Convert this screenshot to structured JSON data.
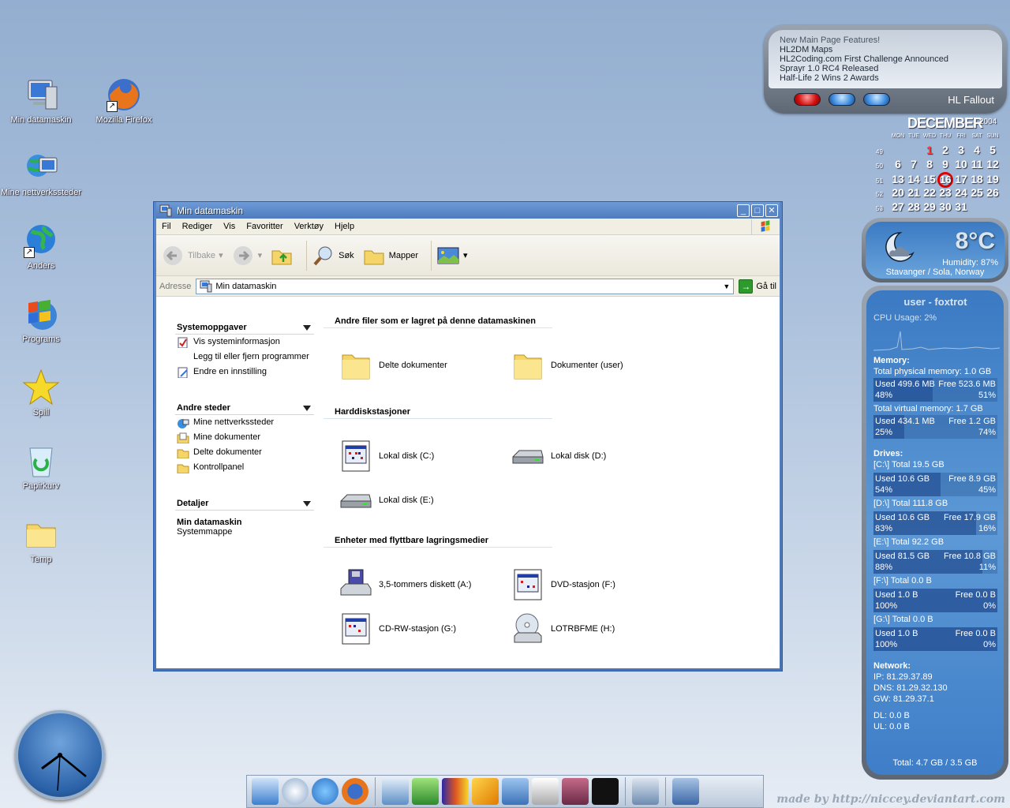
{
  "desktop": {
    "icons": [
      {
        "label": "Min datamaskin",
        "icon": "my-computer-icon"
      },
      {
        "label": "Mozilla Firefox",
        "icon": "firefox-icon"
      },
      {
        "label": "Mine nettverkssteder",
        "icon": "network-places-icon"
      },
      {
        "label": "Anders",
        "icon": "globe-shortcut-icon"
      },
      {
        "label": "Programs",
        "icon": "windows-logo-icon"
      },
      {
        "label": "Spill",
        "icon": "star-icon"
      },
      {
        "label": "Papirkurv",
        "icon": "recycle-bin-icon"
      },
      {
        "label": "Temp",
        "icon": "folder-icon"
      }
    ],
    "credit": "made by http://niccey.deviantart.com"
  },
  "news": {
    "headlines": [
      "New Main Page Features!",
      "HL2DM Maps",
      "HL2Coding.com First Challenge Announced",
      "Sprayr 1.0 RC4 Released",
      "Half-Life 2 Wins 2 Awards"
    ],
    "label": "HL Fallout"
  },
  "calendar": {
    "month": "DECEMBER",
    "year": "2004",
    "weekdays": [
      "MON",
      "TUE",
      "WED",
      "THU",
      "FRI",
      "SAT",
      "SUN"
    ],
    "weeks": [
      {
        "wk": "49",
        "days": [
          "",
          "",
          "1",
          "2",
          "3",
          "4",
          "5"
        ]
      },
      {
        "wk": "50",
        "days": [
          "6",
          "7",
          "8",
          "9",
          "10",
          "11",
          "12"
        ]
      },
      {
        "wk": "51",
        "days": [
          "13",
          "14",
          "15",
          "16",
          "17",
          "18",
          "19"
        ]
      },
      {
        "wk": "52",
        "days": [
          "20",
          "21",
          "22",
          "23",
          "24",
          "25",
          "26"
        ]
      },
      {
        "wk": "53",
        "days": [
          "27",
          "28",
          "29",
          "30",
          "31",
          "",
          ""
        ]
      }
    ],
    "today": "16",
    "colors": {
      "today_ring": "#d00000",
      "sunday": "#ff3a3a"
    }
  },
  "weather": {
    "temp": "8°C",
    "humidity": "Humidity: 87%",
    "location": "Stavanger / Sola, Norway"
  },
  "sysmon": {
    "title": "user - foxtrot",
    "cpu": "CPU Usage: 2%",
    "memory_label": "Memory:",
    "phys_total": "Total physical memory: 1.0 GB",
    "phys": {
      "used": "Used 499.6 MB",
      "free": "Free 523.6 MB",
      "used_pct": "48%",
      "free_pct": "51%",
      "fraction": 0.48
    },
    "virt_total": "Total virtual memory: 1.7 GB",
    "virt": {
      "used": "Used 434.1 MB",
      "free": "Free 1.2 GB",
      "used_pct": "25%",
      "free_pct": "74%",
      "fraction": 0.25
    },
    "drives_label": "Drives:",
    "drives": [
      {
        "total": "[C:\\] Total 19.5 GB",
        "used": "Used 10.6 GB",
        "free": "Free 8.9 GB",
        "used_pct": "54%",
        "free_pct": "45%",
        "fraction": 0.54
      },
      {
        "total": "[D:\\] Total 111.8 GB",
        "used": "Used 10.6 GB",
        "free": "Free 17.9 GB",
        "used_pct": "83%",
        "free_pct": "16%",
        "fraction": 0.83
      },
      {
        "total": "[E:\\] Total 92.2 GB",
        "used": "Used 81.5 GB",
        "free": "Free 10.8 GB",
        "used_pct": "88%",
        "free_pct": "11%",
        "fraction": 0.88
      },
      {
        "total": "[F:\\] Total 0.0 B",
        "used": "Used 1.0 B",
        "free": "Free 0.0 B",
        "used_pct": "100%",
        "free_pct": "0%",
        "fraction": 1.0
      },
      {
        "total": "[G:\\] Total 0.0 B",
        "used": "Used 1.0 B",
        "free": "Free 0.0 B",
        "used_pct": "100%",
        "free_pct": "0%",
        "fraction": 1.0
      }
    ],
    "network_label": "Network:",
    "ip": "IP:  81.29.37.89",
    "dns": "DNS:  81.29.32.130",
    "gw": "GW:  81.29.37.1",
    "dl": "DL: 0.0 B",
    "ul": "UL: 0.0 B",
    "total": "Total: 4.7 GB / 3.5 GB"
  },
  "window": {
    "title": "Min datamaskin",
    "menu": [
      "Fil",
      "Rediger",
      "Vis",
      "Favoritter",
      "Verktøy",
      "Hjelp"
    ],
    "toolbar": {
      "back": "Tilbake",
      "search": "Søk",
      "folders": "Mapper"
    },
    "address": {
      "label": "Adresse",
      "value": "Min datamaskin",
      "go": "Gå til"
    },
    "tasks": {
      "system": {
        "title": "Systemoppgaver",
        "items": [
          "Vis systeminformasjon",
          "Legg til eller fjern programmer",
          "Endre en innstilling"
        ]
      },
      "other": {
        "title": "Andre steder",
        "items": [
          "Mine nettverkssteder",
          "Mine dokumenter",
          "Delte dokumenter",
          "Kontrollpanel"
        ]
      },
      "details": {
        "title": "Detaljer",
        "name": "Min datamaskin",
        "type": "Systemmappe"
      }
    },
    "groups": {
      "files": {
        "title": "Andre filer som er lagret på denne datamaskinen",
        "items": [
          "Delte dokumenter",
          "Dokumenter (user)"
        ]
      },
      "hdd": {
        "title": "Harddiskstasjoner",
        "items": [
          "Lokal disk (C:)",
          "Lokal disk (D:)",
          "Lokal disk (E:)"
        ]
      },
      "removable": {
        "title": "Enheter med flyttbare lagringsmedier",
        "items": [
          "3,5-tommers diskett (A:)",
          "DVD-stasjon (F:)",
          "CD-RW-stasjon (G:)",
          "LOTRBFME (H:)"
        ]
      }
    }
  }
}
